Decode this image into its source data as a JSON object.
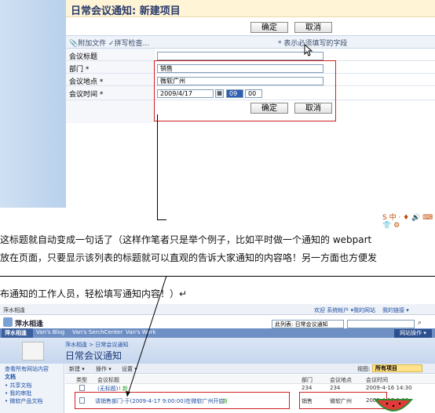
{
  "form": {
    "title": "日常会议通知: 新建项目",
    "ok_label": "确定",
    "cancel_label": "取消",
    "toolbar": {
      "attach_label": "附加文件",
      "spell_label": "拼写检查...",
      "required_note": "* 表示必须填写的字段"
    },
    "fields": {
      "title_label": "会议标题",
      "dept_label": "部门 *",
      "dept_value": "销售",
      "location_label": "会议地点 *",
      "location_value": "微软广州",
      "time_label": "会议时间 *",
      "date_value": "2009/4/17",
      "hour_value": "09",
      "minute_value": "00"
    },
    "ime_text": "S 中 · ♦ 🔊 ⌨ 👕 ⚙"
  },
  "article": {
    "line1": "这标题就自动变成一句话了（这样作笔者只是举个例子，比如平时做一个通知的 webpart",
    "line2": "放在页面，只要显示该列表的标题就可以直观的告诉大家通知的内容咯！另一方面也方便发",
    "line3": "布通知的工作人员，轻松填写通知内容！）↵"
  },
  "list": {
    "top_left": "萍水相逢",
    "top_links": [
      "欢迎 系统帐户 ▾",
      "我的网站",
      "我的链接 ▾"
    ],
    "site_name": "萍水相逢",
    "search_scope": "此列表: 日常会议通知",
    "tabs": [
      "萍水相逢",
      "Van's Blog",
      "Van's SerchCenter",
      "Van's Work"
    ],
    "site_actions": "网站操作 ▾",
    "breadcrumb": "萍水相逢 > 日常会议通知",
    "page_title": "日常会议通知",
    "left_nav": [
      "查看所有网站内容",
      "文档",
      "共享文档",
      "我的审批",
      "微软产品文档"
    ],
    "toolbar": [
      "新建 ▾",
      "操作 ▾",
      "设置 ▾"
    ],
    "view_label": "视图:",
    "view_value": "所有项目",
    "columns": [
      "类型",
      "会议标题",
      "部门",
      "会议地点",
      "会议时间"
    ],
    "rows": [
      {
        "title": "(无标题)",
        "new": "! 新",
        "dept": "234",
        "location": "234",
        "time": "2009-4-16 14:30"
      },
      {
        "title": "请销售部门-于(2009-4-17 9:00:00)在微软广州开会",
        "new": "! 新",
        "dept": "销售",
        "location": "微软广州",
        "time": "2009-4-17 9:00"
      }
    ]
  }
}
